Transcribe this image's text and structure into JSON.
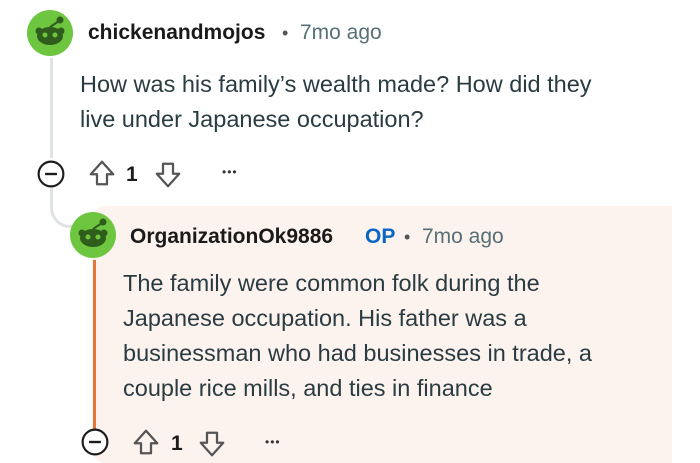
{
  "comment1": {
    "username": "chickenandmojos",
    "separator": "•",
    "time": "7mo ago",
    "body_line1": "How was his family’s wealth made? How did they",
    "body_line2": "live under Japanese occupation?",
    "score": "1",
    "more": "•••"
  },
  "comment2": {
    "username": "OrganizationOk9886",
    "op_badge": "OP",
    "separator": "•",
    "time": "7mo ago",
    "body_lines": [
      "The family were common folk during the",
      "Japanese occupation. His father was a",
      "businessman who had businesses in trade, a",
      "couple rice mills, and ties in finance"
    ],
    "score": "1",
    "more": "•••"
  },
  "colors": {
    "avatar_green": "#6ec540",
    "op_blue": "#0a66c2",
    "highlight_bg": "#fcf2ee",
    "highlight_line": "#e0783c",
    "thread_line": "#dfe3e6"
  },
  "icons": [
    "snoo-avatar-icon",
    "collapse-minus-icon",
    "upvote-arrow-icon",
    "downvote-arrow-icon",
    "more-options-icon"
  ]
}
